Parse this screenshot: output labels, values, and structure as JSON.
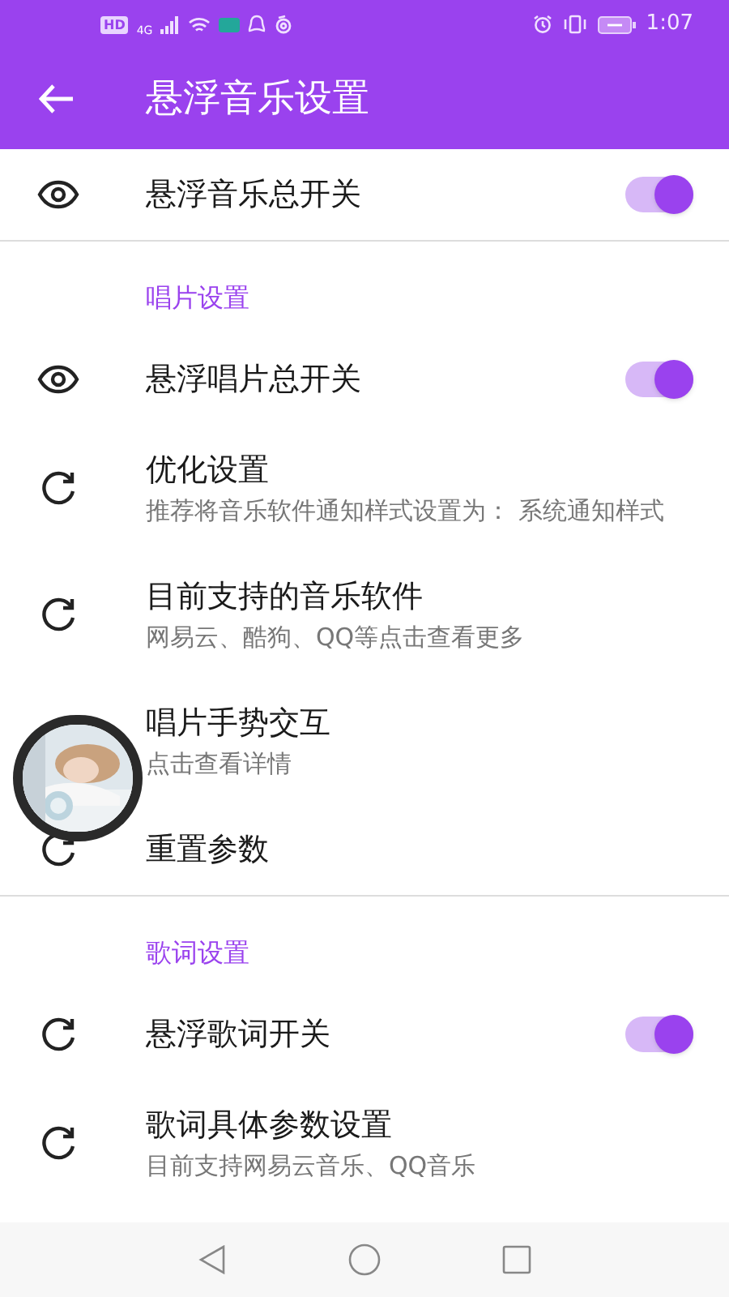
{
  "status_bar": {
    "badges": [
      "HD",
      "4G"
    ],
    "time": "1:07"
  },
  "header": {
    "title": "悬浮音乐设置"
  },
  "items": [
    {
      "kind": "toggle",
      "title": "悬浮音乐总开关",
      "on": true
    },
    {
      "kind": "section",
      "title": "唱片设置"
    },
    {
      "kind": "toggle",
      "title": "悬浮唱片总开关",
      "on": true
    },
    {
      "kind": "link",
      "title": "优化设置",
      "subtitle": "推荐将音乐软件通知样式设置为： 系统通知样式"
    },
    {
      "kind": "link",
      "title": "目前支持的音乐软件",
      "subtitle": "网易云、酷狗、QQ等点击查看更多"
    },
    {
      "kind": "link",
      "title": "唱片手势交互",
      "subtitle": "点击查看详情"
    },
    {
      "kind": "link",
      "title": "重置参数"
    },
    {
      "kind": "section",
      "title": "歌词设置"
    },
    {
      "kind": "toggle",
      "title": "悬浮歌词开关",
      "on": true
    },
    {
      "kind": "link",
      "title": "歌词具体参数设置",
      "subtitle": "目前支持网易云音乐、QQ音乐"
    }
  ]
}
